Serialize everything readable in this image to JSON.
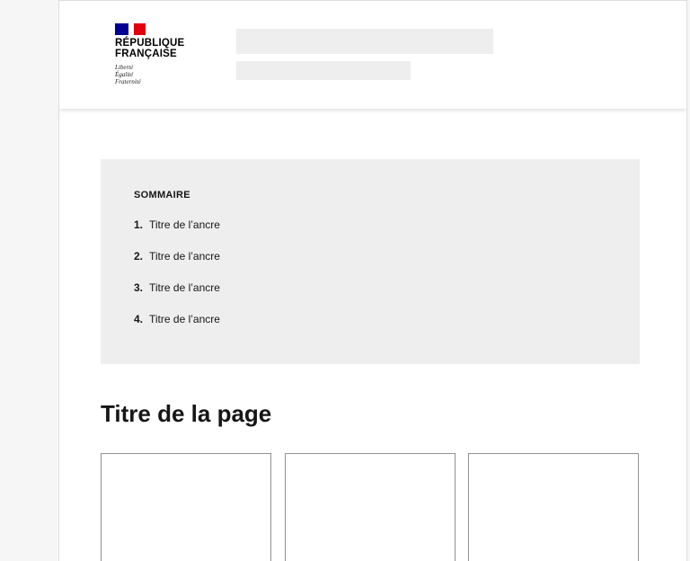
{
  "header": {
    "logo": {
      "name_line1": "RÉPUBLIQUE",
      "name_line2": "FRANÇAISE",
      "motto_line1": "Liberté",
      "motto_line2": "Égalité",
      "motto_line3": "Fraternité",
      "flag_colors": [
        "#000091",
        "#ffffff",
        "#e1000f"
      ]
    }
  },
  "summary": {
    "title": "SOMMAIRE",
    "items": [
      {
        "number": "1.",
        "label": "Titre de l’ancre"
      },
      {
        "number": "2.",
        "label": "Titre de l’ancre"
      },
      {
        "number": "3.",
        "label": "Titre de l’ancre"
      },
      {
        "number": "4.",
        "label": "Titre de l’ancre"
      }
    ]
  },
  "main": {
    "page_title": "Titre de la page"
  }
}
